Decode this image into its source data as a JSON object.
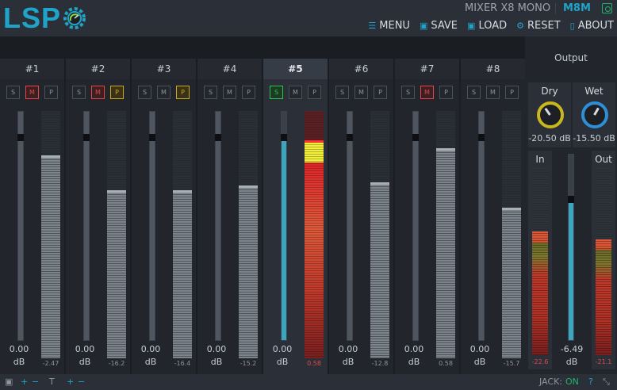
{
  "header": {
    "logo_text": "LSP",
    "plugin_title": "MIXER X8 MONO",
    "plugin_code": "M8M",
    "menu": [
      {
        "icon": "menu-icon",
        "label": "MENU"
      },
      {
        "icon": "save-icon",
        "label": "SAVE"
      },
      {
        "icon": "load-icon",
        "label": "LOAD"
      },
      {
        "icon": "reset-icon",
        "label": "RESET"
      },
      {
        "icon": "about-icon",
        "label": "ABOUT"
      }
    ]
  },
  "channels": [
    {
      "title": "#1",
      "solo": false,
      "mute": true,
      "phase": false,
      "fader_pos": 0.905,
      "fader_value": "0.00",
      "unit": "dB",
      "meter_level": 0.82,
      "meter_peak": 0.82,
      "meter_value": "-2.47",
      "meter_red": false
    },
    {
      "title": "#2",
      "solo": false,
      "mute": true,
      "phase": true,
      "fader_pos": 0.905,
      "fader_value": "0.00",
      "unit": "dB",
      "meter_level": 0.68,
      "meter_peak": 0.68,
      "meter_value": "-16.2",
      "meter_red": false
    },
    {
      "title": "#3",
      "solo": false,
      "mute": false,
      "phase": true,
      "fader_pos": 0.905,
      "fader_value": "0.00",
      "unit": "dB",
      "meter_level": 0.68,
      "meter_peak": 0.68,
      "meter_value": "-16.4",
      "meter_red": false
    },
    {
      "title": "#4",
      "solo": false,
      "mute": false,
      "phase": false,
      "fader_pos": 0.905,
      "fader_value": "0.00",
      "unit": "dB",
      "meter_level": 0.7,
      "meter_peak": 0.7,
      "meter_value": "-15.2",
      "meter_red": false
    },
    {
      "title": "#5",
      "solo": true,
      "mute": false,
      "phase": false,
      "fader_pos": 0.905,
      "fader_value": "0.00",
      "unit": "dB",
      "meter_level": 0.88,
      "meter_peak": 0.88,
      "meter_value": "0.58",
      "meter_red": true,
      "active": true
    },
    {
      "title": "#6",
      "solo": false,
      "mute": false,
      "phase": false,
      "fader_pos": 0.905,
      "fader_value": "0.00",
      "unit": "dB",
      "meter_level": 0.71,
      "meter_peak": 0.71,
      "meter_value": "-12.8",
      "meter_red": false
    },
    {
      "title": "#7",
      "solo": false,
      "mute": true,
      "phase": false,
      "fader_pos": 0.905,
      "fader_value": "0.00",
      "unit": "dB",
      "meter_level": 0.85,
      "meter_peak": 0.85,
      "meter_value": "0.58",
      "meter_red": false
    },
    {
      "title": "#8",
      "solo": false,
      "mute": false,
      "phase": false,
      "fader_pos": 0.905,
      "fader_value": "0.00",
      "unit": "dB",
      "meter_level": 0.61,
      "meter_peak": 0.61,
      "meter_value": "-15.7",
      "meter_red": false
    }
  ],
  "buttons": {
    "solo": "S",
    "mute": "M",
    "phase": "P"
  },
  "output": {
    "title": "Output",
    "dry": {
      "label": "Dry",
      "value": "-20.50 dB",
      "color": "#c9b81d"
    },
    "wet": {
      "label": "Wet",
      "value": "-15.50 dB",
      "color": "#2e8fd6"
    },
    "in": {
      "label": "In",
      "value": "-22.6",
      "level": 0.66
    },
    "out": {
      "label": "Out",
      "value": "-21.1",
      "level": 0.62
    },
    "fader": {
      "value": "-6.49",
      "unit": "dB",
      "pos": 0.78
    }
  },
  "footer": {
    "jack_label": "JACK:",
    "jack_status": "ON"
  },
  "colors": {
    "accent": "#1fa3c9",
    "mute": "#e24646",
    "phase": "#c9a820",
    "solo": "#2ec24a",
    "ok": "#1eb36d"
  }
}
